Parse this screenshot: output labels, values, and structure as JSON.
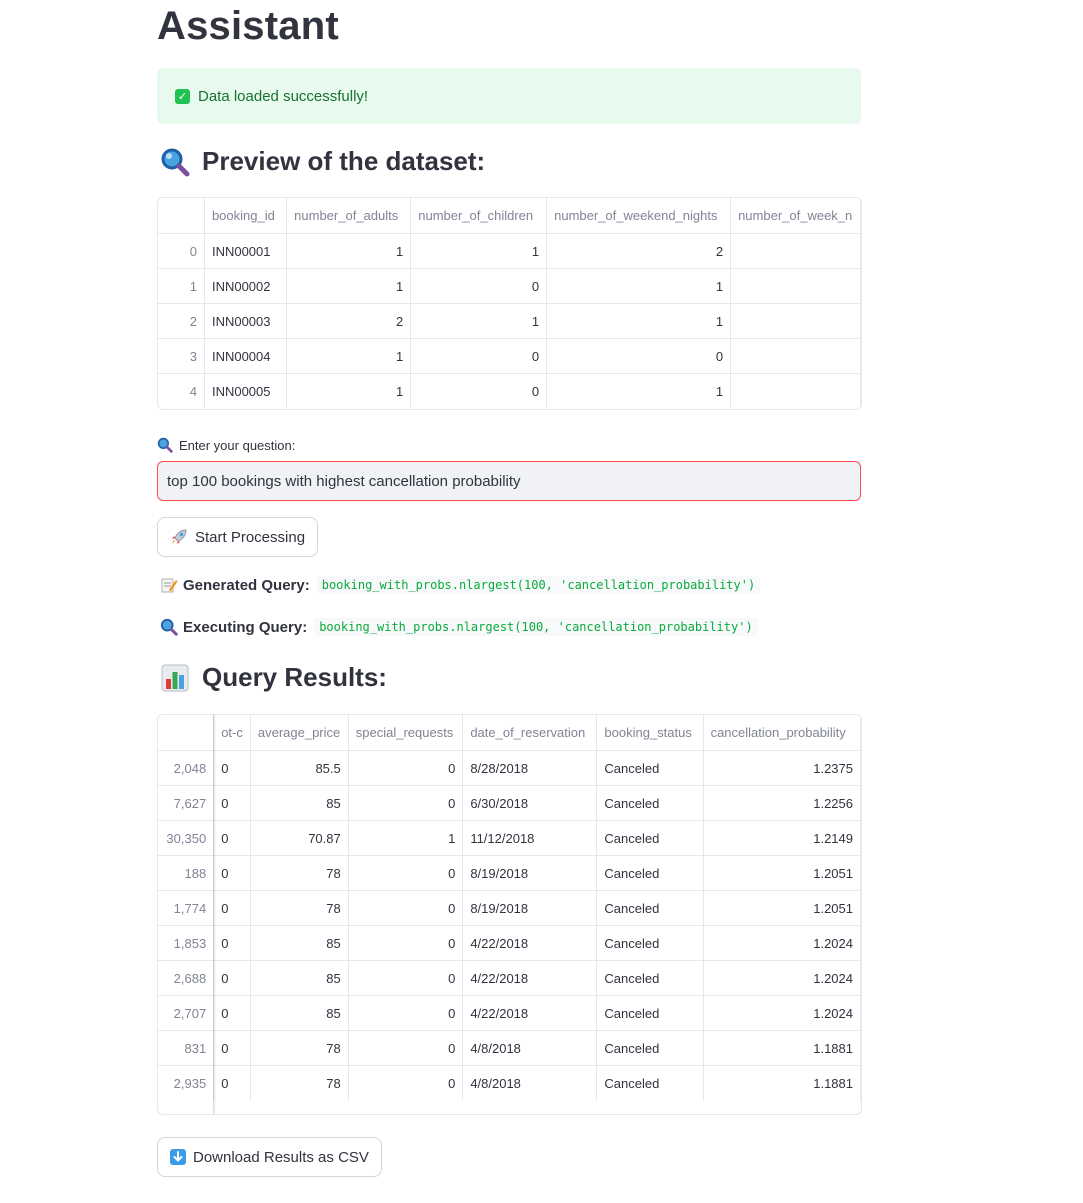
{
  "page": {
    "title": "Assistant"
  },
  "alert": {
    "text": "Data loaded successfully!"
  },
  "preview": {
    "heading": "Preview of the dataset:",
    "columns": [
      "",
      "booking_id",
      "number_of_adults",
      "number_of_children",
      "number_of_weekend_nights",
      "number_of_week_n"
    ],
    "rows": [
      [
        "0",
        "INN00001",
        "1",
        "1",
        "2",
        ""
      ],
      [
        "1",
        "INN00002",
        "1",
        "0",
        "1",
        ""
      ],
      [
        "2",
        "INN00003",
        "2",
        "1",
        "1",
        ""
      ],
      [
        "3",
        "INN00004",
        "1",
        "0",
        "0",
        ""
      ],
      [
        "4",
        "INN00005",
        "1",
        "0",
        "1",
        ""
      ]
    ]
  },
  "question": {
    "label": "Enter your question:",
    "value": "top 100 bookings with highest cancellation probability"
  },
  "start_button": {
    "label": "Start Processing"
  },
  "generated": {
    "label": "Generated Query:",
    "code": "booking_with_probs.nlargest(100, 'cancellation_probability')"
  },
  "executing": {
    "label": "Executing Query:",
    "code": "booking_with_probs.nlargest(100, 'cancellation_probability')"
  },
  "results": {
    "heading": "Query Results:",
    "columns": [
      "",
      "ot-c",
      "average_price",
      "special_requests",
      "date_of_reservation",
      "booking_status",
      "cancellation_probability"
    ],
    "rows": [
      [
        "2,048",
        "0",
        "85.5",
        "0",
        "8/28/2018",
        "Canceled",
        "1.2375"
      ],
      [
        "7,627",
        "0",
        "85",
        "0",
        "6/30/2018",
        "Canceled",
        "1.2256"
      ],
      [
        "30,350",
        "0",
        "70.87",
        "1",
        "11/12/2018",
        "Canceled",
        "1.2149"
      ],
      [
        "188",
        "0",
        "78",
        "0",
        "8/19/2018",
        "Canceled",
        "1.2051"
      ],
      [
        "1,774",
        "0",
        "78",
        "0",
        "8/19/2018",
        "Canceled",
        "1.2051"
      ],
      [
        "1,853",
        "0",
        "85",
        "0",
        "4/22/2018",
        "Canceled",
        "1.2024"
      ],
      [
        "2,688",
        "0",
        "85",
        "0",
        "4/22/2018",
        "Canceled",
        "1.2024"
      ],
      [
        "2,707",
        "0",
        "85",
        "0",
        "4/22/2018",
        "Canceled",
        "1.2024"
      ],
      [
        "831",
        "0",
        "78",
        "0",
        "4/8/2018",
        "Canceled",
        "1.1881"
      ],
      [
        "2,935",
        "0",
        "78",
        "0",
        "4/8/2018",
        "Canceled",
        "1.1881"
      ]
    ]
  },
  "download_button": {
    "label": "Download Results as CSV"
  },
  "colors": {
    "accent_red": "#ff4b4b",
    "success_bg": "#e8f9ee",
    "success_text": "#177233",
    "code_green": "#09ab3b"
  }
}
